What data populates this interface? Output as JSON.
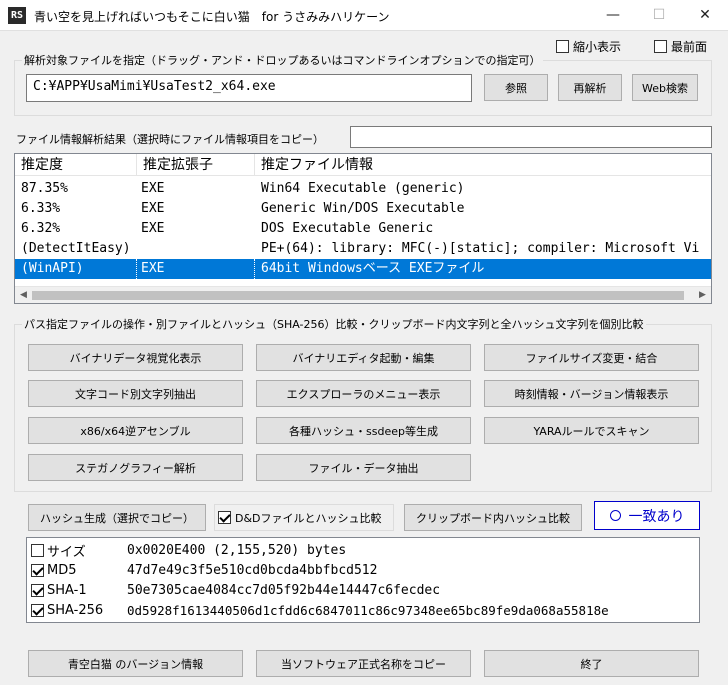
{
  "window": {
    "title": "青い空を見上げればいつもそこに白い猫　for うさみみハリケーン",
    "icon_text": "RS",
    "minimize": "—",
    "maximize": "☐",
    "close": "✕"
  },
  "top_options": {
    "compact_label": "縮小表示",
    "compact_checked": false,
    "topmost_label": "最前面",
    "topmost_checked": false
  },
  "file_group": {
    "label": "解析対象ファイルを指定（ドラッグ・アンド・ドロップあるいはコマンドラインオプションでの指定可）",
    "path_value": "C:¥APP¥UsaMimi¥UsaTest2_x64.exe",
    "browse_label": "参照",
    "reanalyze_label": "再解析",
    "websearch_label": "Web検索"
  },
  "results": {
    "label": "ファイル情報解析結果（選択時にファイル情報項目をコピー）",
    "copy_field_value": "",
    "columns": [
      "推定度",
      "推定拡張子",
      "推定ファイル情報"
    ],
    "rows": [
      {
        "score": " 87.35%",
        "ext": "EXE",
        "info": "Win64 Executable (generic)",
        "selected": false
      },
      {
        "score": "  6.33%",
        "ext": "EXE",
        "info": "Generic Win/DOS Executable",
        "selected": false
      },
      {
        "score": "  6.32%",
        "ext": "EXE",
        "info": "DOS Executable Generic",
        "selected": false
      },
      {
        "score": "(DetectItEasy)",
        "ext": "",
        "info": "PE+(64): library: MFC(-)[static]; compiler: Microsoft Vi",
        "selected": false
      },
      {
        "score": "(WinAPI)",
        "ext": "EXE",
        "info": "64bit Windowsベース EXEファイル",
        "selected": true
      }
    ],
    "scroll_left": "◀",
    "scroll_right": "▶"
  },
  "operations": {
    "label": "パス指定ファイルの操作・別ファイルとハッシュ（SHA-256）比較・クリップボード内文字列と全ハッシュ文字列を個別比較",
    "buttons": [
      "バイナリデータ視覚化表示",
      "バイナリエディタ起動・編集",
      "ファイルサイズ変更・結合",
      "文字コード別文字列抽出",
      "エクスプローラのメニュー表示",
      "時刻情報・バージョン情報表示",
      "x86/x64逆アセンブル",
      "各種ハッシュ・ssdeep等生成",
      "YARAルールでスキャン",
      "ステガノグラフィー解析",
      "ファイル・データ抽出"
    ]
  },
  "hash": {
    "generate_label": "ハッシュ生成（選択でコピー）",
    "dnd_compare_label": "D&Dファイルとハッシュ比較",
    "dnd_compare_checked": true,
    "clipboard_compare_label": "クリップボード内ハッシュ比較",
    "match_label": "一致あり",
    "rows": [
      {
        "label": "サイズ",
        "checked": false,
        "value": "0x0020E400 (2,155,520) bytes"
      },
      {
        "label": "MD5",
        "checked": true,
        "value": "47d7e49c3f5e510cd0bcda4bbfbcd512"
      },
      {
        "label": "SHA-1",
        "checked": true,
        "value": "50e7305cae4084cc7d05f92b44e14447c6fecdec"
      },
      {
        "label": "SHA-256",
        "checked": true,
        "value": "0d5928f1613440506d1cfdd6c6847011c86c97348ee65bc89fe9da068a55818e"
      }
    ]
  },
  "footer": {
    "version_label": "青空白猫 のバージョン情報",
    "copy_name_label": "当ソフトウェア正式名称をコピー",
    "exit_label": "終了"
  }
}
